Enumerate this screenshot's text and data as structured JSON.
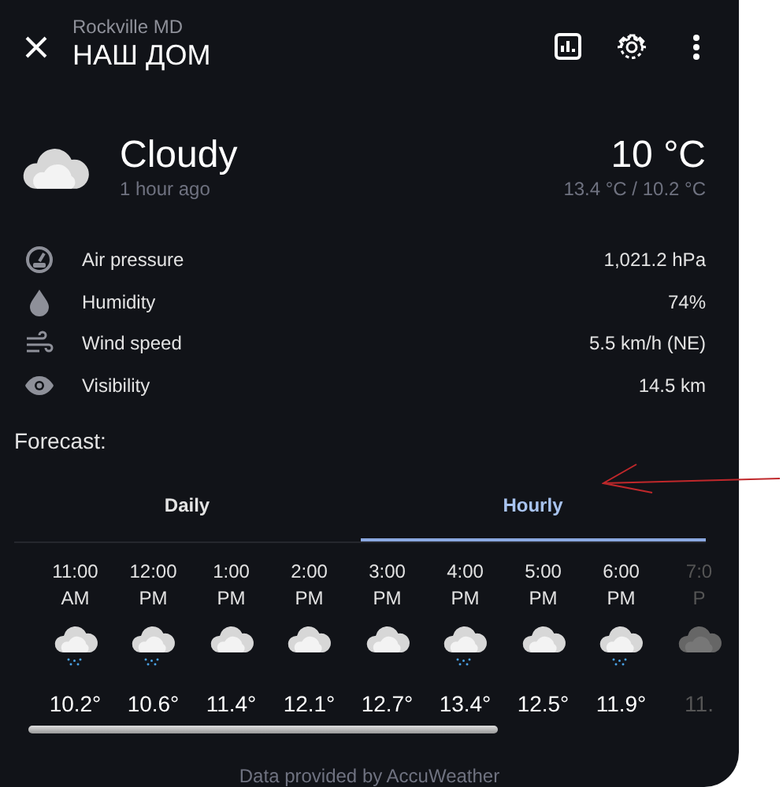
{
  "header": {
    "subtitle": "Rockville MD",
    "title": "НАШ ДОМ"
  },
  "current": {
    "condition": "Cloudy",
    "updated": "1 hour ago",
    "temperature": "10 °C",
    "range": "13.4 °C / 10.2 °C"
  },
  "attributes": [
    {
      "kind": "pressure",
      "label": "Air pressure",
      "value": "1,021.2 hPa"
    },
    {
      "kind": "humidity",
      "label": "Humidity",
      "value": "74%"
    },
    {
      "kind": "wind",
      "label": "Wind speed",
      "value": "5.5 km/h (NE)"
    },
    {
      "kind": "visibility",
      "label": "Visibility",
      "value": "14.5 km"
    }
  ],
  "forecast_label": "Forecast:",
  "tabs": [
    {
      "label": "Daily",
      "selected": false
    },
    {
      "label": "Hourly",
      "selected": true
    }
  ],
  "hourly": [
    {
      "time": "11:00",
      "period": "AM",
      "kind": "rain",
      "temp": "10.2°"
    },
    {
      "time": "12:00",
      "period": "PM",
      "kind": "rain",
      "temp": "10.6°"
    },
    {
      "time": "1:00",
      "period": "PM",
      "kind": "cloudy",
      "temp": "11.4°"
    },
    {
      "time": "2:00",
      "period": "PM",
      "kind": "cloudy",
      "temp": "12.1°"
    },
    {
      "time": "3:00",
      "period": "PM",
      "kind": "cloudy",
      "temp": "12.7°"
    },
    {
      "time": "4:00",
      "period": "PM",
      "kind": "rain",
      "temp": "13.4°"
    },
    {
      "time": "5:00",
      "period": "PM",
      "kind": "cloudy",
      "temp": "12.5°"
    },
    {
      "time": "6:00",
      "period": "PM",
      "kind": "rain",
      "temp": "11.9°"
    },
    {
      "time": "7:0",
      "period": "P",
      "kind": "cloudy",
      "temp": "11."
    }
  ],
  "footer": "Data provided by AccuWeather"
}
